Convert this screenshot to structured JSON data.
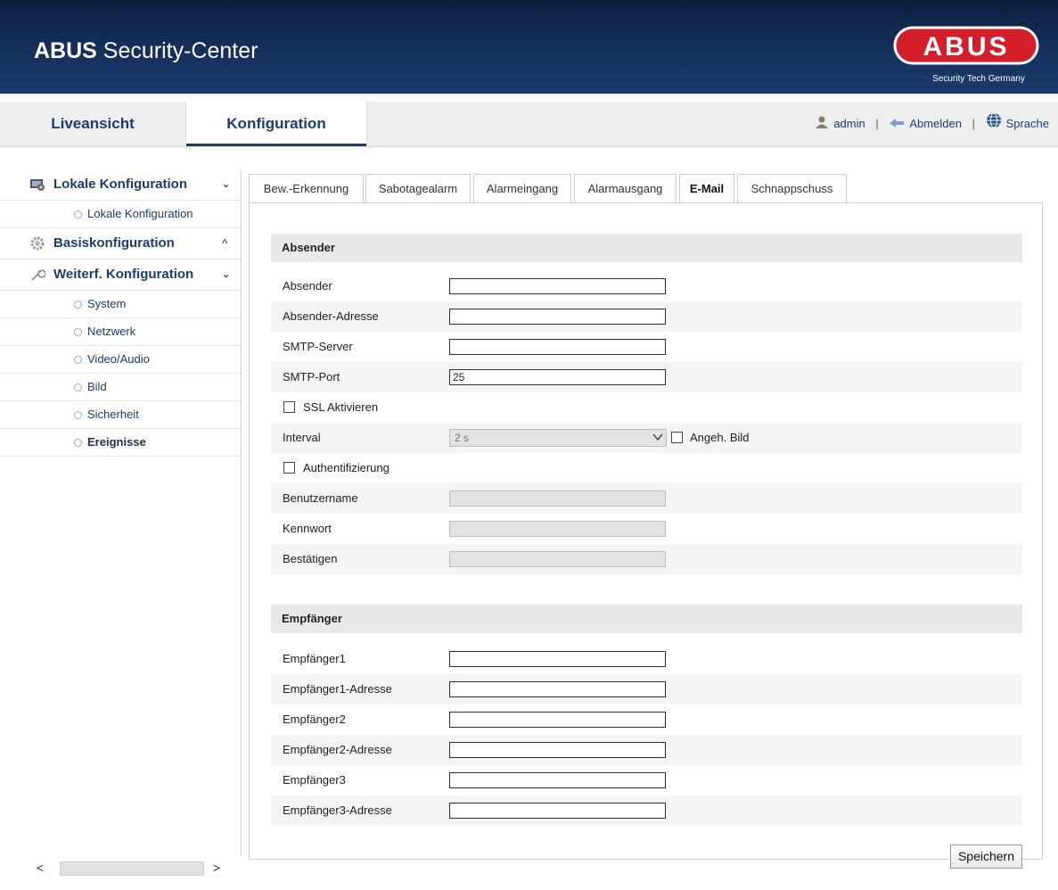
{
  "header": {
    "title_bold": "ABUS",
    "title_rest": " Security-Center",
    "logo_text": "ABUS",
    "logo_tagline": "Security Tech Germany"
  },
  "nav": {
    "live_tab": "Liveansicht",
    "config_tab": "Konfiguration"
  },
  "userbar": {
    "user": "admin",
    "logout": "Abmelden",
    "language": "Sprache",
    "separator": "|"
  },
  "sidebar": {
    "groups": [
      {
        "label": "Lokale Konfiguration",
        "chevron": "⌄",
        "items": [
          "Lokale Konfiguration"
        ]
      },
      {
        "label": "Basiskonfiguration",
        "chevron": "^"
      },
      {
        "label": "Weiterf. Konfiguration",
        "chevron": "⌄",
        "items": [
          "System",
          "Netzwerk",
          "Video/Audio",
          "Bild",
          "Sicherheit",
          "Ereignisse"
        ]
      }
    ],
    "active_item": "Ereignisse"
  },
  "tabs": [
    "Bew.-Erkennung",
    "Sabotagealarm",
    "Alarmeingang",
    "Alarmausgang",
    "E-Mail",
    "Schnappschuss"
  ],
  "active_tab": "E-Mail",
  "sender": {
    "section_title": "Absender",
    "fields": [
      {
        "label": "Absender",
        "value": ""
      },
      {
        "label": "Absender-Adresse",
        "value": ""
      },
      {
        "label": "SMTP-Server",
        "value": ""
      },
      {
        "label": "SMTP-Port",
        "value": "25"
      }
    ],
    "ssl_label": "SSL Aktivieren",
    "ssl_checked": false,
    "interval_label": "Interval",
    "interval_value": "2 s",
    "attach_label": "Angeh. Bild",
    "attach_checked": false,
    "auth_label": "Authentifizierung",
    "auth_checked": false,
    "auth_fields": [
      {
        "label": "Benutzername",
        "value": ""
      },
      {
        "label": "Kennwort",
        "value": ""
      },
      {
        "label": "Bestätigen",
        "value": ""
      }
    ]
  },
  "receiver": {
    "section_title": "Empfänger",
    "fields": [
      {
        "label": "Empfänger1",
        "value": ""
      },
      {
        "label": "Empfänger1-Adresse",
        "value": ""
      },
      {
        "label": "Empfänger2",
        "value": ""
      },
      {
        "label": "Empfänger2-Adresse",
        "value": ""
      },
      {
        "label": "Empfänger3",
        "value": ""
      },
      {
        "label": "Empfänger3-Adresse",
        "value": ""
      }
    ]
  },
  "scroll": {
    "left": "<",
    "right": ">"
  },
  "save_label": "Speichern",
  "colors": {
    "header_bg": "#16305c",
    "nav_text": "#1a3e72",
    "logo_red": "#d31f2a"
  }
}
